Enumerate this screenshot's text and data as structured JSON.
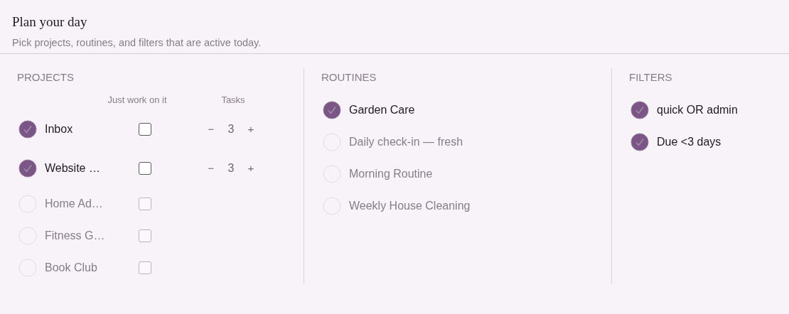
{
  "header": {
    "title": "Plan your day",
    "subtitle": "Pick projects, routines, and filters that are active today."
  },
  "projects": {
    "heading": "PROJECTS",
    "columns": [
      "Just work on it",
      "Tasks"
    ],
    "items": [
      {
        "label": "Inbox",
        "selected": true,
        "just_work_on_it": false,
        "tasks": "3",
        "minus": "−",
        "plus": "+"
      },
      {
        "label": "Website …",
        "selected": true,
        "just_work_on_it": false,
        "tasks": "3",
        "minus": "−",
        "plus": "+"
      },
      {
        "label": "Home Ad…",
        "selected": false,
        "just_work_on_it": false
      },
      {
        "label": "Fitness G…",
        "selected": false,
        "just_work_on_it": false
      },
      {
        "label": "Book Club",
        "selected": false,
        "just_work_on_it": false
      }
    ]
  },
  "routines": {
    "heading": "ROUTINES",
    "items": [
      {
        "label": "Garden Care",
        "selected": true
      },
      {
        "label": "Daily check-in — fresh",
        "selected": false
      },
      {
        "label": "Morning Routine",
        "selected": false
      },
      {
        "label": "Weekly House Cleaning",
        "selected": false
      }
    ]
  },
  "filters": {
    "heading": "FILTERS",
    "items": [
      {
        "label": "quick OR admin",
        "selected": true
      },
      {
        "label": "Due <3 days",
        "selected": true
      }
    ]
  }
}
